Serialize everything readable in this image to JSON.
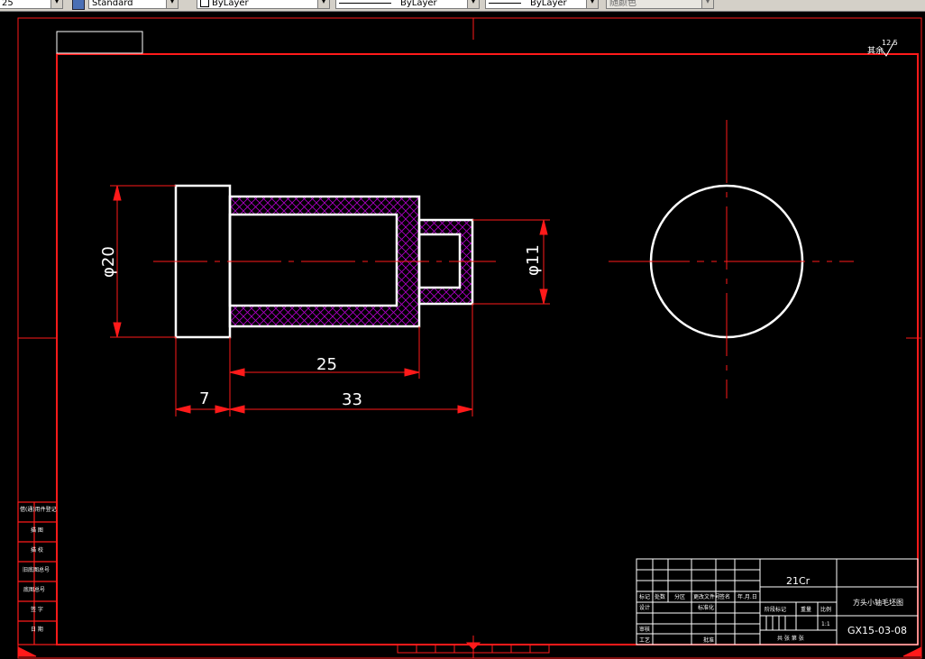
{
  "toolbar": {
    "layer_value": "25",
    "text_style": "Standard",
    "color_value": "ByLayer",
    "linetype_value": "ByLayer",
    "lineweight_value": "ByLayer",
    "plotstyle_value": "随颜色"
  },
  "drawing": {
    "roughness_label": "其余",
    "roughness_value": "12.5",
    "dimensions": {
      "dia20": "φ20",
      "dia11": "φ11",
      "len25": "25",
      "len7": "7",
      "len33": "33"
    }
  },
  "title_block": {
    "material": "21Cr",
    "drawing_name": "方头小轴毛坯图",
    "drawing_number": "GX15-03-08",
    "scale": "1:1",
    "cells": {
      "biaoji": "标记",
      "chushu": "处数",
      "fenqu": "分区",
      "gengai": "更改文件号",
      "qianming": "签名",
      "nianyueri": "年.月.日",
      "sheji": "设计",
      "biaozhunhua": "标准化",
      "jieduan": "阶段标记",
      "zhongliang": "重量",
      "bili": "比例",
      "shenhe": "审核",
      "gongyi": "工艺",
      "pizhun": "批准",
      "gong_zhang": "共 张 第 张"
    }
  },
  "side_block": [
    "借(通)用件登记",
    "描 图",
    "描 校",
    "旧底图总号",
    "底图总号",
    "签 字",
    "日 期"
  ]
}
